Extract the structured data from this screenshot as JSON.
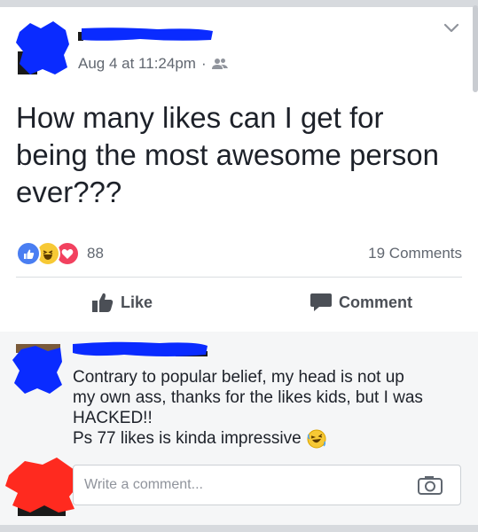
{
  "post": {
    "timestamp": "Aug 4 at 11:24pm",
    "separator": "·",
    "text": "How many likes can I get for being the most awesome person ever???",
    "reaction_count": "88",
    "comments_count": "19 Comments"
  },
  "actions": {
    "like_label": "Like",
    "comment_label": "Comment"
  },
  "comment": {
    "lines": [
      "Contrary to popular belief, my head is not up",
      "my own ass, thanks for the likes kids, but I was",
      "HACKED!!",
      "Ps 77 likes is kinda impressive"
    ]
  },
  "composer": {
    "placeholder": "Write a comment..."
  },
  "colors": {
    "redaction": "#0a2bff",
    "redaction_red": "#ff2a1f",
    "like_blue": "#4a7ef2",
    "love_red": "#f2415f",
    "haha_yellow": "#f7c935"
  },
  "icons": [
    "chevron-down-icon",
    "friends-icon",
    "like-reaction-icon",
    "haha-reaction-icon",
    "love-reaction-icon",
    "thumbs-up-icon",
    "comment-bubble-icon",
    "camera-icon",
    "laughing-emoji-icon"
  ]
}
